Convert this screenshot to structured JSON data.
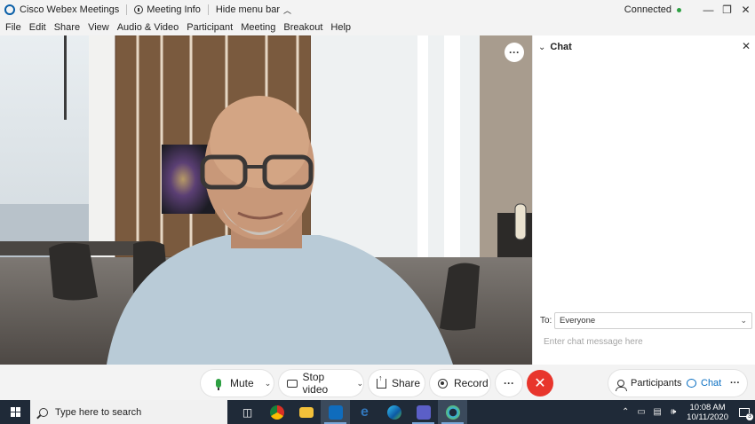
{
  "titlebar": {
    "app_title": "Cisco Webex Meetings",
    "meeting_info": "Meeting Info",
    "hide_menu_bar": "Hide menu bar",
    "status": "Connected",
    "status_color": "#2ea043"
  },
  "menubar": {
    "items": [
      "File",
      "Edit",
      "Share",
      "View",
      "Audio & Video",
      "Participant",
      "Meeting",
      "Breakout",
      "Help"
    ]
  },
  "video": {
    "more_icon": "more-icon"
  },
  "chat": {
    "title": "Chat",
    "to_label": "To:",
    "to_value": "Everyone",
    "input_placeholder": "Enter chat message here"
  },
  "controls": {
    "mute": "Mute",
    "stop_video": "Stop video",
    "share": "Share",
    "record": "Record",
    "participants": "Participants",
    "chat": "Chat",
    "end_color": "#e8352c"
  },
  "taskbar": {
    "search_placeholder": "Type here to search",
    "time": "10:08 AM",
    "date": "10/11/2020",
    "notification_count": "3",
    "apps": [
      "task-view-icon",
      "chrome-icon",
      "file-explorer-icon",
      "outlook-icon",
      "edge-legacy-icon",
      "edge-icon",
      "teams-icon",
      "webex-icon"
    ]
  }
}
